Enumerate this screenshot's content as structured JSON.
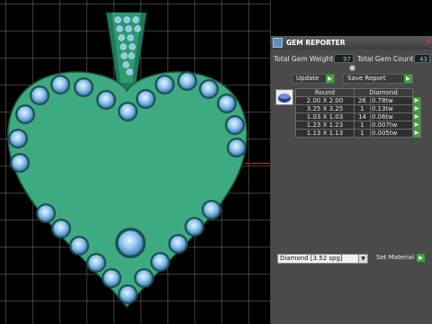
{
  "panel": {
    "title": "GEM REPORTER",
    "close_icon": "close-icon",
    "app_icon": "app-icon"
  },
  "totals": {
    "weight_label": "Total Gem Weight",
    "weight_value": "97",
    "count_label": "Total Gem Count",
    "count_value": "43"
  },
  "buttons": {
    "update": "Update",
    "save_report": "Save Report",
    "set_material": "Set Material"
  },
  "table": {
    "headers": [
      "Round",
      "Diamond"
    ],
    "rows": [
      {
        "size": "2.00 X 2.00",
        "count": "26",
        "weight": "0.78tw"
      },
      {
        "size": "3.25 X 3.25",
        "count": "1",
        "weight": "0.13tw"
      },
      {
        "size": "1.03 X 1.03",
        "count": "14",
        "weight": "0.06tw"
      },
      {
        "size": "1.23 X 1.23",
        "count": "1",
        "weight": "0.007tw"
      },
      {
        "size": "1.13 X 1.13",
        "count": "1",
        "weight": "0.005tw"
      }
    ]
  },
  "material": {
    "selected": "Diamond",
    "spg": "[3.52 spg]"
  },
  "colors": {
    "pendant": "#3daa82",
    "gem": "#8fc6ec",
    "accent_green": "#3aa43a"
  }
}
